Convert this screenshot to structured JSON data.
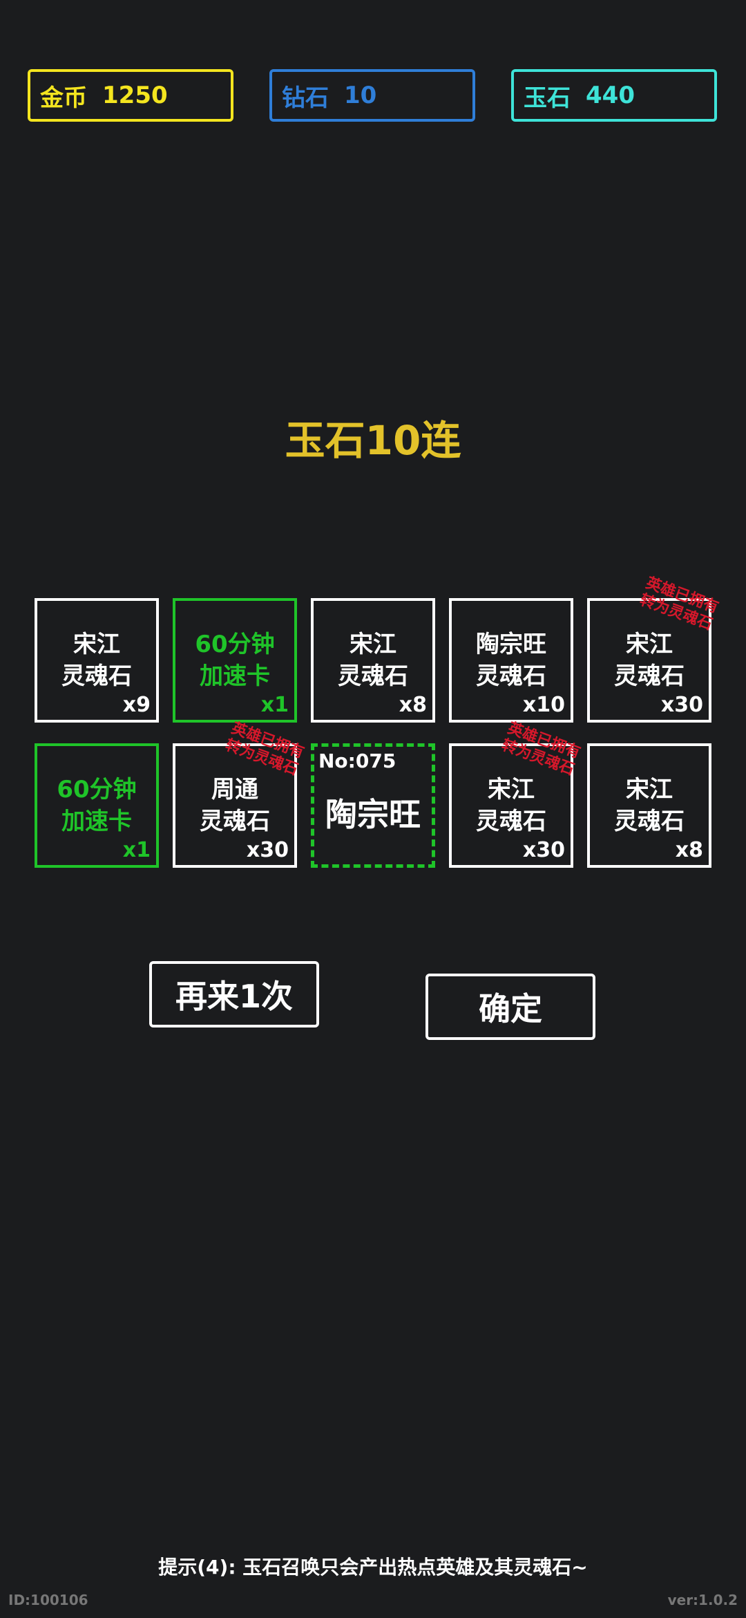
{
  "currencies": {
    "gold": {
      "name": "金币",
      "value": "1250",
      "color": "#f4e51f"
    },
    "diamond": {
      "name": "钻石",
      "value": "10",
      "color": "#2f7ed8"
    },
    "jade": {
      "name": "玉石",
      "value": "440",
      "color": "#3ee3d8"
    }
  },
  "title": "玉石10连",
  "stamp_text": {
    "line1": "英雄已拥有",
    "line2": "转为灵魂石"
  },
  "items": [
    {
      "line1": "宋江",
      "line2": "灵魂石",
      "count": "x9"
    },
    {
      "line1": "60分钟",
      "line2": "加速卡",
      "count": "x1"
    },
    {
      "line1": "宋江",
      "line2": "灵魂石",
      "count": "x8"
    },
    {
      "line1": "陶宗旺",
      "line2": "灵魂石",
      "count": "x10"
    },
    {
      "line1": "宋江",
      "line2": "灵魂石",
      "count": "x30"
    },
    {
      "line1": "60分钟",
      "line2": "加速卡",
      "count": "x1"
    },
    {
      "line1": "周通",
      "line2": "灵魂石",
      "count": "x30"
    },
    {
      "no": "No:075",
      "name": "陶宗旺"
    },
    {
      "line1": "宋江",
      "line2": "灵魂石",
      "count": "x30"
    },
    {
      "line1": "宋江",
      "line2": "灵魂石",
      "count": "x8"
    }
  ],
  "buttons": {
    "again": "再来1次",
    "confirm": "确定"
  },
  "tip": "提示(4): 玉石召唤只会产出热点英雄及其灵魂石~",
  "id_text": "ID:100106",
  "version": "ver:1.0.2"
}
